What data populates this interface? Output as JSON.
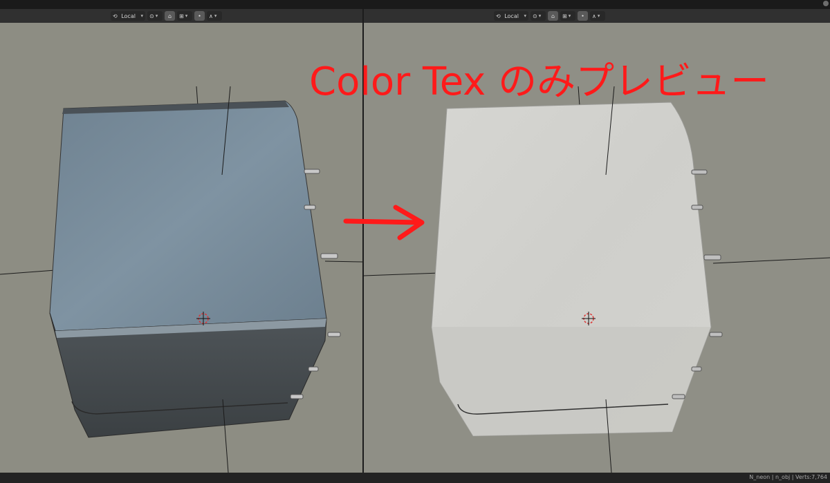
{
  "left_header": {
    "orientation_label": "Local"
  },
  "right_header": {
    "orientation_label": "Local"
  },
  "annotation": {
    "text": "Color Tex のみプレビュー",
    "color": "#ff1a1a"
  },
  "status_bar": {
    "text": "N_neon | n_obj | Verts:7,764"
  },
  "icons": [
    "transform-orientation-icon",
    "snap-icon",
    "proportional-editing-icon",
    "pivot-icon",
    "falloff-icon",
    "crosshair-icon",
    "arrow-icon"
  ],
  "colors": {
    "viewport_bg": "#8f8f86",
    "header_bg": "#303030",
    "cube_color_shaded": "#6a7d8c",
    "cube_color_preview": "#d0d0cc",
    "annotation_red": "#ff1a1a"
  }
}
